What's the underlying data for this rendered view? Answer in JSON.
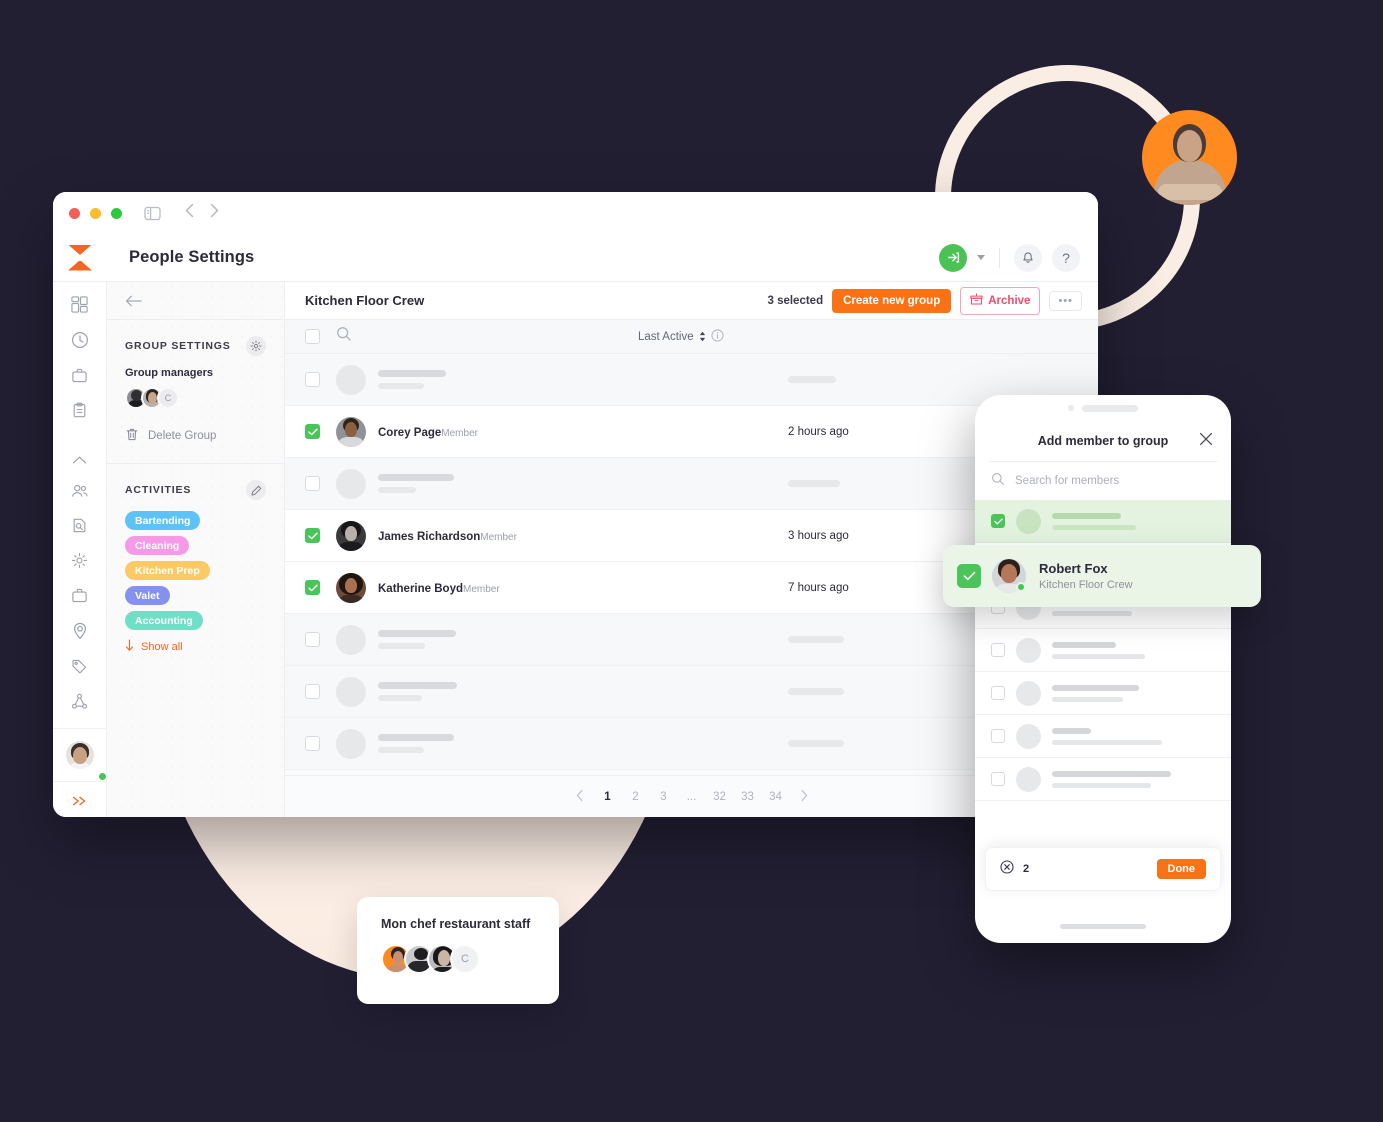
{
  "window": {
    "traffic_lights": [
      "close",
      "minimize",
      "maximize"
    ],
    "sidebar_toggle_icon": "panel-icon",
    "nav_back_icon": "chevron-left-icon",
    "nav_forward_icon": "chevron-right-icon"
  },
  "header": {
    "logo": "hourglass-logo",
    "title": "People Settings",
    "login_icon": "login-arrow-icon",
    "caret_icon": "chevron-down-icon",
    "bell_icon": "bell-icon",
    "help_label": "?"
  },
  "rail": {
    "top_icons": [
      "dashboard-icon",
      "clock-icon",
      "briefcase-icon",
      "clipboard-icon"
    ],
    "bottom_icons": [
      "chevron-up-icon",
      "people-icon",
      "document-search-icon",
      "settings-node-icon",
      "briefcase-icon",
      "location-pin-icon",
      "tag-icon",
      "org-chart-icon"
    ],
    "expand_icon": "double-chevron-right-icon",
    "avatar": "user-avatar"
  },
  "left_panel": {
    "back_icon": "arrow-left-icon",
    "group_settings": {
      "title": "GROUP SETTINGS",
      "gear_icon": "gear-icon",
      "managers_label": "Group managers",
      "managers": [
        "manager-avatar-1",
        "manager-avatar-2"
      ],
      "managers_overflow": "C",
      "delete_icon": "trash-icon",
      "delete_label": "Delete Group"
    },
    "activities": {
      "title": "ACTIVITIES",
      "edit_icon": "pencil-icon",
      "tags": [
        {
          "label": "Bartending",
          "color": "#5dc3f7"
        },
        {
          "label": "Cleaning",
          "color": "#f69ae8"
        },
        {
          "label": "Kitchen Prep",
          "color": "#fcc965"
        },
        {
          "label": "Valet",
          "color": "#8590f0"
        },
        {
          "label": "Accounting",
          "color": "#6fdfc6"
        }
      ],
      "show_all_label": "Show all",
      "show_all_icon": "arrow-down-icon",
      "show_all_color": "#f26522"
    }
  },
  "main": {
    "group_title": "Kitchen Floor Crew",
    "selected_text": "3 selected",
    "create_group_label": "Create new group",
    "archive_label": "Archive",
    "archive_icon": "archive-box-icon",
    "more_label": "•••",
    "search_icon": "search-icon",
    "column_last_active": "Last Active",
    "sort_icon": "sort-arrows-icon",
    "info_icon": "info-icon",
    "rows": [
      {
        "type": "skeleton",
        "checked": false,
        "sk_w": 68,
        "sk2_w": 46,
        "time_w": 48
      },
      {
        "type": "member",
        "checked": true,
        "name": "Corey Page",
        "role": "Member",
        "time": "2 hours ago",
        "avatar": "av-a"
      },
      {
        "type": "skeleton",
        "checked": false,
        "sk_w": 76,
        "sk2_w": 38,
        "time_w": 52
      },
      {
        "type": "member",
        "checked": true,
        "name": "James Richardson",
        "role": "Member",
        "time": "3 hours ago",
        "avatar": "av-b"
      },
      {
        "type": "member",
        "checked": true,
        "name": "Katherine Boyd",
        "role": "Member",
        "time": "7 hours ago",
        "avatar": "av-c"
      },
      {
        "type": "skeleton",
        "checked": false,
        "sk_w": 78,
        "sk2_w": 47,
        "time_w": 56
      },
      {
        "type": "skeleton",
        "checked": false,
        "sk_w": 79,
        "sk2_w": 44,
        "time_w": 56
      },
      {
        "type": "skeleton",
        "checked": false,
        "sk_w": 76,
        "sk2_w": 46,
        "time_w": 56
      }
    ],
    "pagination": {
      "prev_icon": "chevron-left-icon",
      "next_icon": "chevron-right-icon",
      "pages": [
        "1",
        "2",
        "3",
        "...",
        "32",
        "33",
        "34"
      ],
      "current": "1"
    }
  },
  "phone": {
    "title": "Add member to group",
    "close_icon": "close-icon",
    "search_icon": "search-icon",
    "search_placeholder": "Search for members",
    "rows": [
      {
        "checked": true,
        "sk_w": 69,
        "sk2_w": 84
      },
      {
        "checked": false,
        "sk_w": 107,
        "sk2_w": 60
      },
      {
        "checked": false,
        "sk_w": 72,
        "sk2_w": 80
      },
      {
        "checked": false,
        "sk_w": 64,
        "sk2_w": 93
      },
      {
        "checked": false,
        "sk_w": 87,
        "sk2_w": 71
      },
      {
        "checked": false,
        "sk_w": 39,
        "sk2_w": 110
      },
      {
        "checked": false,
        "sk_w": 119,
        "sk2_w": 99
      }
    ],
    "footer": {
      "clear_icon": "clear-circle-icon",
      "count": "2",
      "done_label": "Done"
    },
    "home_indicator": "home-bar"
  },
  "floating_card": {
    "name": "Robert Fox",
    "subtitle": "Kitchen Floor Crew",
    "checked": true,
    "avatar": "robert-fox-avatar",
    "status": "online"
  },
  "mini_card": {
    "title": "Mon chef restaurant staff",
    "avatars": [
      "staff-avatar-1",
      "staff-avatar-2",
      "staff-avatar-3"
    ],
    "overflow": "C"
  },
  "decor": {
    "ring_color": "#faeee4",
    "blob_color": "#fbece2",
    "avatar_bg": "#ff8a1f",
    "background": "#221f33"
  }
}
